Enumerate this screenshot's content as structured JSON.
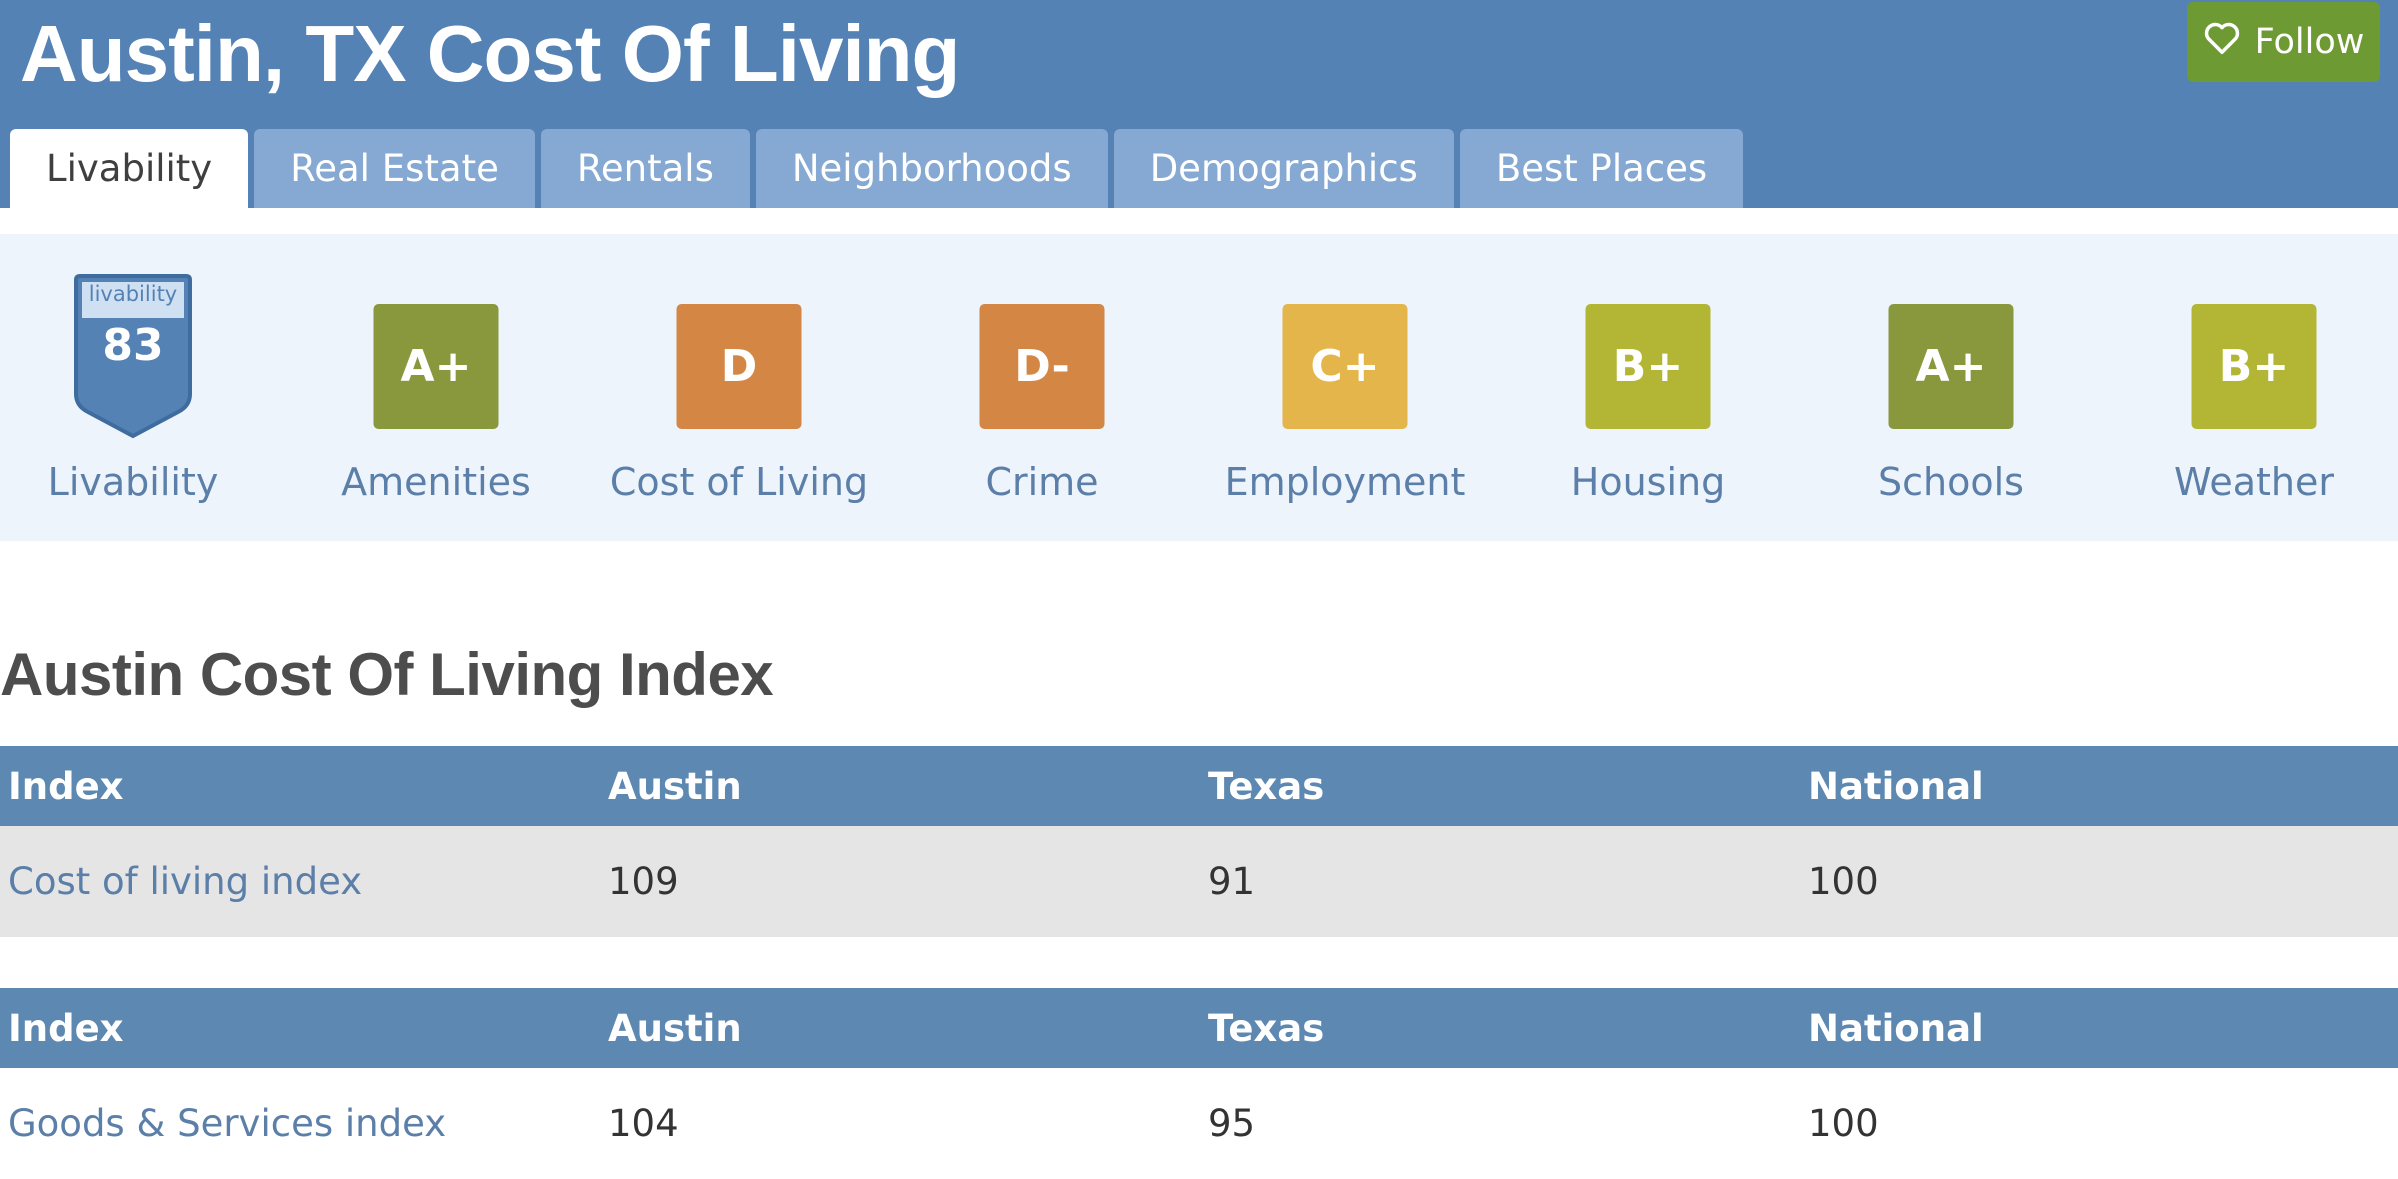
{
  "header": {
    "title": "Austin, TX Cost Of Living",
    "follow_label": "Follow",
    "tabs": [
      {
        "label": "Livability",
        "active": true
      },
      {
        "label": "Real Estate",
        "active": false
      },
      {
        "label": "Rentals",
        "active": false
      },
      {
        "label": "Neighborhoods",
        "active": false
      },
      {
        "label": "Demographics",
        "active": false
      },
      {
        "label": "Best Places",
        "active": false
      }
    ]
  },
  "scores": {
    "livability": {
      "badge_word": "livability",
      "score": "83",
      "label": "Livability"
    },
    "categories": [
      {
        "grade": "A+",
        "label": "Amenities",
        "color": "#89983d"
      },
      {
        "grade": "D",
        "label": "Cost of Living",
        "color": "#d48645"
      },
      {
        "grade": "D-",
        "label": "Crime",
        "color": "#d48645"
      },
      {
        "grade": "C+",
        "label": "Employment",
        "color": "#e3b54b"
      },
      {
        "grade": "B+",
        "label": "Housing",
        "color": "#b2b634"
      },
      {
        "grade": "A+",
        "label": "Schools",
        "color": "#89983d"
      },
      {
        "grade": "B+",
        "label": "Weather",
        "color": "#b2b634"
      }
    ]
  },
  "index_section": {
    "title": "Austin Cost Of Living Index",
    "tables": [
      {
        "headers": [
          "Index",
          "Austin",
          "Texas",
          "National"
        ],
        "row": [
          "Cost of living index",
          "109",
          "91",
          "100"
        ]
      },
      {
        "headers": [
          "Index",
          "Austin",
          "Texas",
          "National"
        ],
        "row": [
          "Goods & Services index",
          "104",
          "95",
          "100"
        ]
      }
    ]
  },
  "colors": {
    "header_bg": "#5482b4",
    "tab_bg": "#85a9d2",
    "follow_bg": "#6e9a33",
    "table_header_bg": "#5d88b2",
    "link": "#5b7fa8"
  }
}
